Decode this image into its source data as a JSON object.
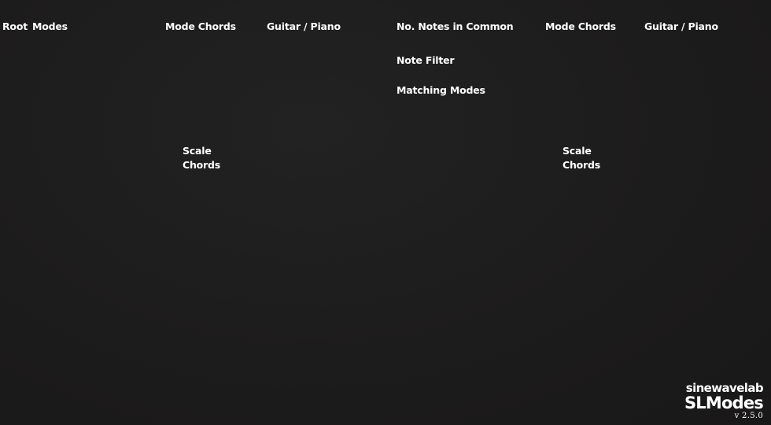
{
  "left_panel": {
    "root_label": "Root",
    "modes_label": "Modes",
    "mode_chords_label": "Mode Chords",
    "guitar_piano_label": "Guitar / Piano",
    "scale_chords_line1": "Scale",
    "scale_chords_line2": "Chords"
  },
  "right_panel": {
    "notes_in_common_label": "No. Notes in Common",
    "note_filter_label": "Note Filter",
    "matching_modes_label": "Matching Modes",
    "mode_chords_label": "Mode Chords",
    "guitar_piano_label": "Guitar / Piano",
    "scale_chords_line1": "Scale",
    "scale_chords_line2": "Chords"
  },
  "branding": {
    "company": "sinewavelab",
    "product": "SLModes",
    "version": "v 2.5.0"
  }
}
